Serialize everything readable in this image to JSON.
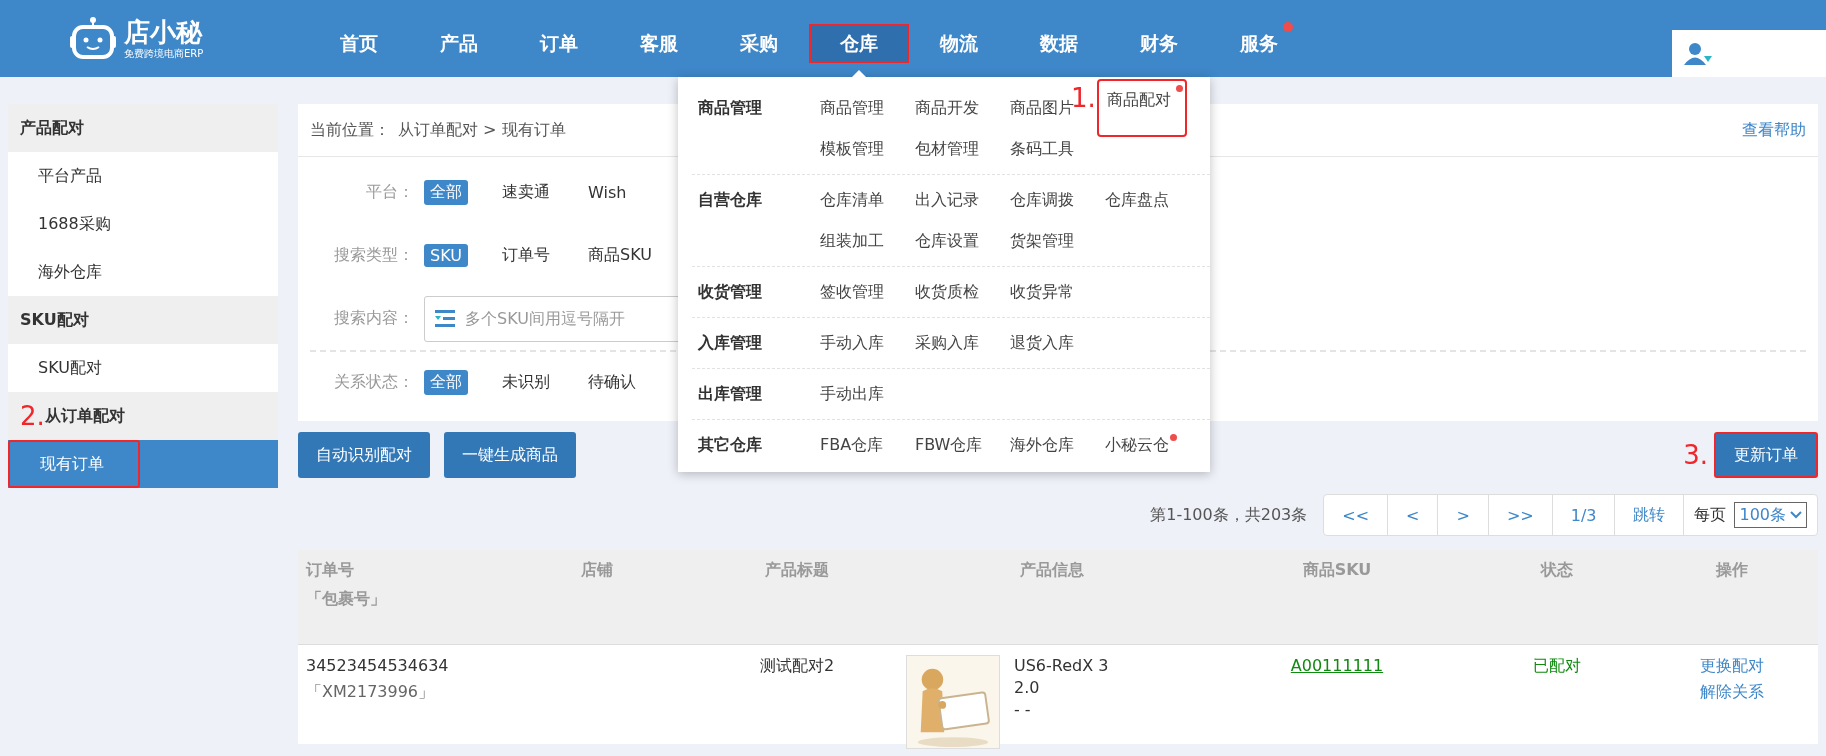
{
  "logo": {
    "name": "店小秘",
    "tagline": "免费跨境电商ERP"
  },
  "nav": [
    {
      "label": "首页",
      "selected": false,
      "highlighted": false,
      "badge": false
    },
    {
      "label": "产品",
      "selected": false,
      "highlighted": false,
      "badge": false
    },
    {
      "label": "订单",
      "selected": false,
      "highlighted": false,
      "badge": false
    },
    {
      "label": "客服",
      "selected": false,
      "highlighted": false,
      "badge": false
    },
    {
      "label": "采购",
      "selected": false,
      "highlighted": false,
      "badge": false
    },
    {
      "label": "仓库",
      "selected": true,
      "highlighted": true,
      "badge": false
    },
    {
      "label": "物流",
      "selected": false,
      "highlighted": false,
      "badge": false
    },
    {
      "label": "数据",
      "selected": false,
      "highlighted": false,
      "badge": false
    },
    {
      "label": "财务",
      "selected": false,
      "highlighted": false,
      "badge": false
    },
    {
      "label": "服务",
      "selected": false,
      "highlighted": false,
      "badge": true
    }
  ],
  "sidebar": [
    {
      "title": "产品配对",
      "items": [
        {
          "label": "平台产品",
          "selected": false,
          "highlighted": false
        },
        {
          "label": "1688采购",
          "selected": false,
          "highlighted": false
        },
        {
          "label": "海外仓库",
          "selected": false,
          "highlighted": false
        }
      ]
    },
    {
      "title": "SKU配对",
      "items": [
        {
          "label": "SKU配对",
          "selected": false,
          "highlighted": false
        }
      ]
    },
    {
      "title": "从订单配对",
      "annotation": "2.",
      "items": [
        {
          "label": "现有订单",
          "selected": true,
          "highlighted": true
        }
      ]
    }
  ],
  "breadcrumb": {
    "label": "当前位置：",
    "path": "从订单配对 > 现有订单",
    "help": "查看帮助"
  },
  "filters": [
    {
      "kind": "options",
      "label": "平台：",
      "options": [
        {
          "label": "全部",
          "selected": true
        },
        {
          "label": "速卖通",
          "selected": false
        },
        {
          "label": "Wish",
          "selected": false
        }
      ]
    },
    {
      "kind": "options",
      "label": "搜索类型：",
      "options": [
        {
          "label": "SKU",
          "selected": true
        },
        {
          "label": "订单号",
          "selected": false
        },
        {
          "label": "商品SKU",
          "selected": false
        }
      ]
    },
    {
      "kind": "input",
      "label": "搜索内容：",
      "placeholder": "多个SKU间用逗号隔开"
    },
    {
      "kind": "options",
      "label": "关系状态：",
      "options": [
        {
          "label": "全部",
          "selected": true
        },
        {
          "label": "未识别",
          "selected": false
        },
        {
          "label": "待确认",
          "selected": false
        }
      ]
    }
  ],
  "actions": [
    "自动识别配对",
    "一键生成商品"
  ],
  "update_button": {
    "label": "更新订单",
    "annotation": "3.",
    "highlighted": true
  },
  "pagination": {
    "summary": "第1-100条，共203条",
    "buttons": [
      "<<",
      "<",
      ">",
      ">>",
      "1/3",
      "跳转"
    ],
    "per_page_label": "每页",
    "per_page": "100条"
  },
  "table": {
    "columns": [
      {
        "label": "订单号",
        "sublabel": "「包裹号」"
      },
      {
        "label": "店铺"
      },
      {
        "label": "产品标题"
      },
      {
        "label": "产品信息"
      },
      {
        "label": "商品SKU"
      },
      {
        "label": "状态"
      },
      {
        "label": "操作"
      }
    ],
    "rows": [
      {
        "order": "34523454534634",
        "package": "「XM2173996」",
        "title": "测试配对2",
        "image": {
          "kind": "picture"
        },
        "info": [
          "US6-RedX 3",
          "2.0",
          "- -"
        ],
        "sku": "A00111111",
        "status": "已配对",
        "actions": [
          "更换配对",
          "解除关系"
        ]
      }
    ]
  },
  "dropdown": {
    "sections": [
      {
        "title": "商品管理",
        "items": [
          {
            "label": "商品管理",
            "highlighted": false,
            "badge": false
          },
          {
            "label": "商品开发",
            "highlighted": false,
            "badge": false
          },
          {
            "label": "商品图片",
            "highlighted": false,
            "badge": false
          },
          {
            "label": "商品配对",
            "highlighted": true,
            "badge": true,
            "annotation": "1."
          },
          {
            "label": "模板管理",
            "highlighted": false,
            "badge": false
          },
          {
            "label": "包材管理",
            "highlighted": false,
            "badge": false
          },
          {
            "label": "条码工具",
            "highlighted": false,
            "badge": false
          }
        ]
      },
      {
        "title": "自营仓库",
        "items": [
          {
            "label": "仓库清单",
            "highlighted": false,
            "badge": false
          },
          {
            "label": "出入记录",
            "highlighted": false,
            "badge": false
          },
          {
            "label": "仓库调拨",
            "highlighted": false,
            "badge": false
          },
          {
            "label": "仓库盘点",
            "highlighted": false,
            "badge": false
          },
          {
            "label": "组装加工",
            "highlighted": false,
            "badge": false
          },
          {
            "label": "仓库设置",
            "highlighted": false,
            "badge": false
          },
          {
            "label": "货架管理",
            "highlighted": false,
            "badge": false
          }
        ]
      },
      {
        "title": "收货管理",
        "items": [
          {
            "label": "签收管理",
            "highlighted": false,
            "badge": false
          },
          {
            "label": "收货质检",
            "highlighted": false,
            "badge": false
          },
          {
            "label": "收货异常",
            "highlighted": false,
            "badge": false
          }
        ]
      },
      {
        "title": "入库管理",
        "items": [
          {
            "label": "手动入库",
            "highlighted": false,
            "badge": false
          },
          {
            "label": "采购入库",
            "highlighted": false,
            "badge": false
          },
          {
            "label": "退货入库",
            "highlighted": false,
            "badge": false
          }
        ]
      },
      {
        "title": "出库管理",
        "items": [
          {
            "label": "手动出库",
            "highlighted": false,
            "badge": false
          }
        ]
      },
      {
        "title": "其它仓库",
        "items": [
          {
            "label": "FBA仓库",
            "highlighted": false,
            "badge": false
          },
          {
            "label": "FBW仓库",
            "highlighted": false,
            "badge": false
          },
          {
            "label": "海外仓库",
            "highlighted": false,
            "badge": false
          },
          {
            "label": "小秘云仓",
            "highlighted": false,
            "badge": true
          }
        ]
      }
    ]
  }
}
